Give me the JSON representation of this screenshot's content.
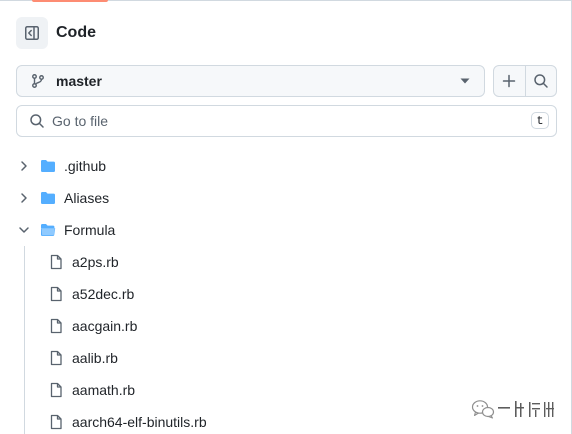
{
  "header": {
    "title": "Code",
    "panel_toggle_icon": "sidebar-collapse-icon"
  },
  "branch": {
    "name": "master",
    "branch_icon": "git-branch-icon",
    "caret_icon": "triangle-down-icon",
    "add_icon": "plus-icon",
    "search_icon": "search-icon"
  },
  "search": {
    "placeholder": "Go to file",
    "shortcut": "t"
  },
  "tree": {
    "folders": [
      {
        "name": ".github",
        "expanded": false
      },
      {
        "name": "Aliases",
        "expanded": false
      },
      {
        "name": "Formula",
        "expanded": true
      }
    ],
    "files": [
      "a2ps.rb",
      "a52dec.rb",
      "aacgain.rb",
      "aalib.rb",
      "aamath.rb",
      "aarch64-elf-binutils.rb"
    ]
  },
  "colors": {
    "folder": "#54aeff",
    "icon_muted": "#59636e",
    "border": "#d1d9e0",
    "accent": "#fd8c73"
  }
}
